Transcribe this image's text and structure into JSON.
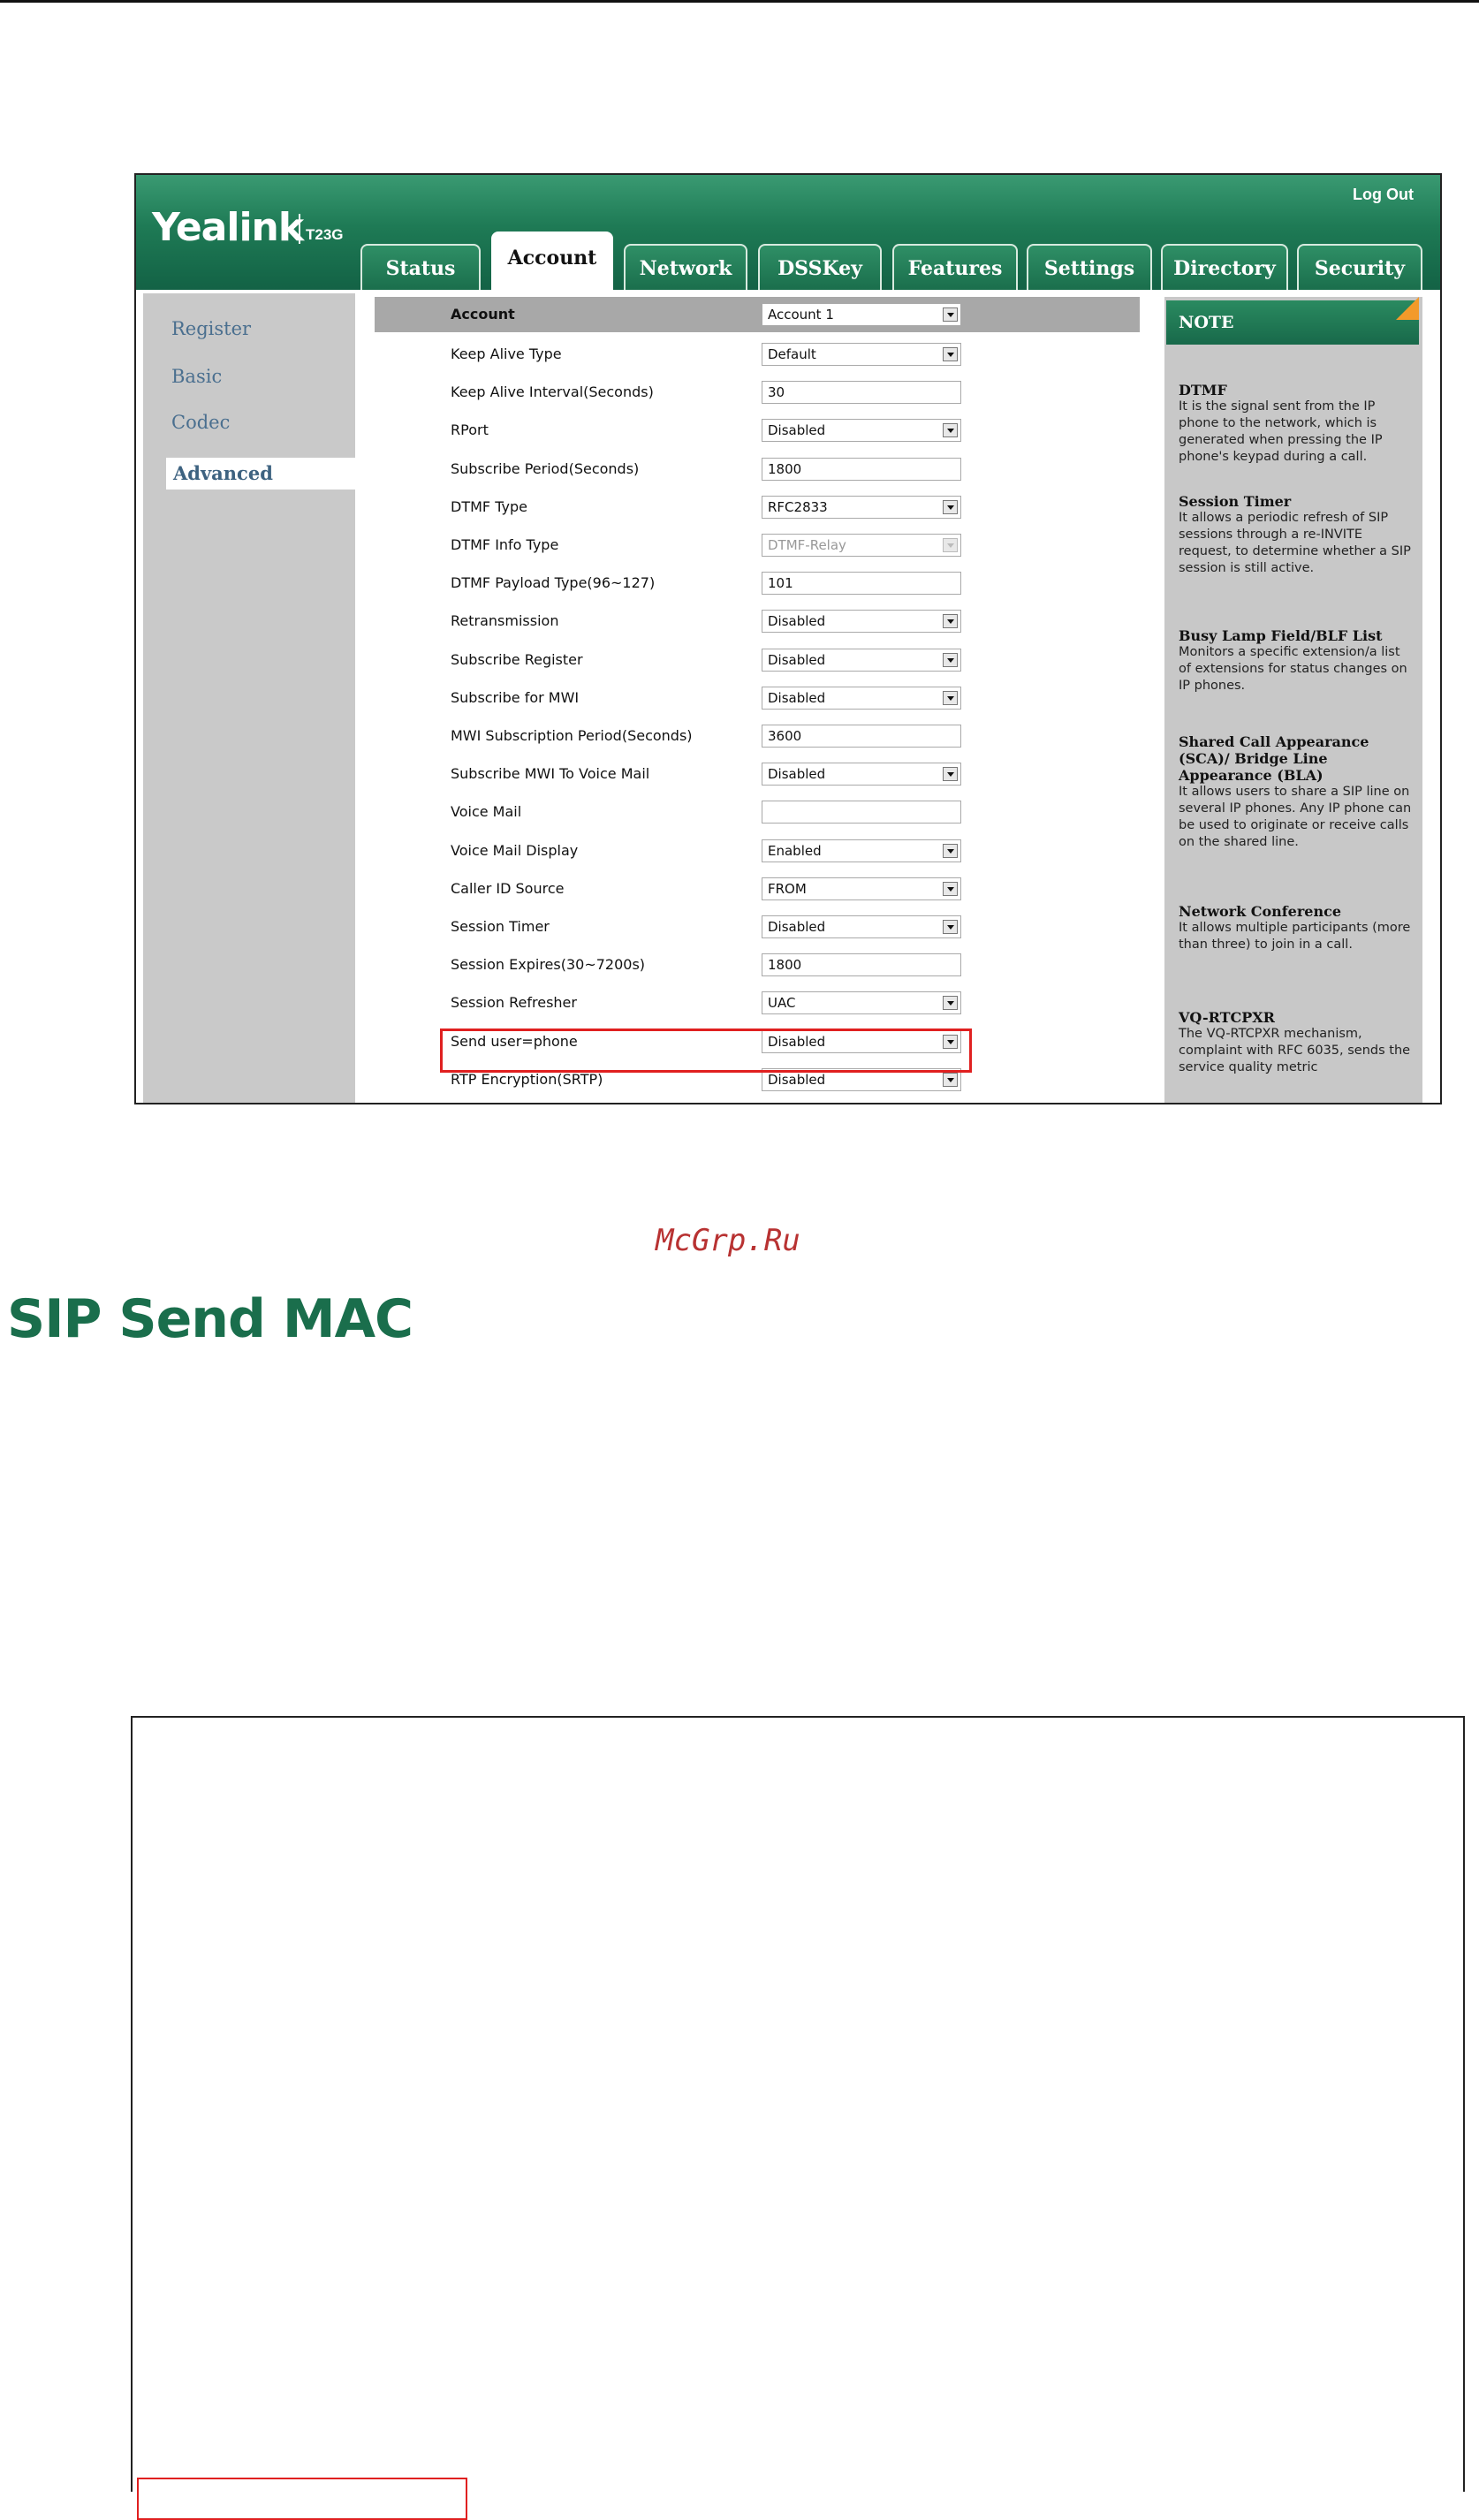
{
  "brand": {
    "logo": "Yealink",
    "model": "T23G"
  },
  "header": {
    "logout": "Log Out"
  },
  "tabs": [
    {
      "label": "Status",
      "active": false
    },
    {
      "label": "Account",
      "active": true
    },
    {
      "label": "Network",
      "active": false
    },
    {
      "label": "DSSKey",
      "active": false
    },
    {
      "label": "Features",
      "active": false
    },
    {
      "label": "Settings",
      "active": false
    },
    {
      "label": "Directory",
      "active": false
    },
    {
      "label": "Security",
      "active": false
    }
  ],
  "sidebar": {
    "items": [
      {
        "label": "Register",
        "active": false
      },
      {
        "label": "Basic",
        "active": false
      },
      {
        "label": "Codec",
        "active": false
      },
      {
        "label": "Advanced",
        "active": true
      }
    ]
  },
  "form": {
    "header": {
      "label": "Account",
      "value": "Account 1"
    },
    "rows": [
      {
        "label": "Keep Alive Type",
        "value": "Default",
        "type": "select"
      },
      {
        "label": "Keep Alive Interval(Seconds)",
        "value": "30",
        "type": "text"
      },
      {
        "label": "RPort",
        "value": "Disabled",
        "type": "select"
      },
      {
        "label": "Subscribe Period(Seconds)",
        "value": "1800",
        "type": "text"
      },
      {
        "label": "DTMF Type",
        "value": "RFC2833",
        "type": "select"
      },
      {
        "label": "DTMF Info Type",
        "value": "DTMF-Relay",
        "type": "select-disabled"
      },
      {
        "label": "DTMF Payload Type(96~127)",
        "value": "101",
        "type": "text"
      },
      {
        "label": "Retransmission",
        "value": "Disabled",
        "type": "select"
      },
      {
        "label": "Subscribe Register",
        "value": "Disabled",
        "type": "select"
      },
      {
        "label": "Subscribe for MWI",
        "value": "Disabled",
        "type": "select"
      },
      {
        "label": "MWI Subscription Period(Seconds)",
        "value": "3600",
        "type": "text"
      },
      {
        "label": "Subscribe MWI To Voice Mail",
        "value": "Disabled",
        "type": "select"
      },
      {
        "label": "Voice Mail",
        "value": "",
        "type": "text"
      },
      {
        "label": "Voice Mail Display",
        "value": "Enabled",
        "type": "select"
      },
      {
        "label": "Caller ID Source",
        "value": "FROM",
        "type": "select"
      },
      {
        "label": "Session Timer",
        "value": "Disabled",
        "type": "select"
      },
      {
        "label": "Session Expires(30~7200s)",
        "value": "1800",
        "type": "text"
      },
      {
        "label": "Session Refresher",
        "value": "UAC",
        "type": "select"
      },
      {
        "label": "Send user=phone",
        "value": "Disabled",
        "type": "select",
        "highlighted": true
      },
      {
        "label": "RTP Encryption(SRTP)",
        "value": "Disabled",
        "type": "select"
      }
    ]
  },
  "note": {
    "title": "NOTE",
    "sections": [
      {
        "title": "DTMF",
        "text": "It is the signal sent from the IP phone to the network, which is generated when pressing the IP phone's keypad during a call."
      },
      {
        "title": "Session Timer",
        "text": "It allows a periodic refresh of SIP sessions through a re-INVITE request, to determine whether a SIP session is still active."
      },
      {
        "title": "Busy Lamp Field/BLF List",
        "text": "Monitors a specific extension/a list of extensions for status changes on IP phones."
      },
      {
        "title": "Shared Call Appearance (SCA)/ Bridge Line Appearance (BLA)",
        "text": "It allows users to share a SIP line on several IP phones. Any IP phone can be used to originate or receive calls on the shared line."
      },
      {
        "title": "Network Conference",
        "text": "It allows multiple participants (more than three) to join in a call."
      },
      {
        "title": "VQ-RTCPXR",
        "text": "The VQ-RTCPXR mechanism, complaint with RFC 6035, sends the service quality metric"
      }
    ]
  },
  "page": {
    "watermark": "McGrp.Ru",
    "section_heading": "SIP Send MAC"
  },
  "colors": {
    "brand_green": "#1e7a55",
    "highlight_red": "#e02020",
    "heading_green": "#1a6e4c"
  }
}
